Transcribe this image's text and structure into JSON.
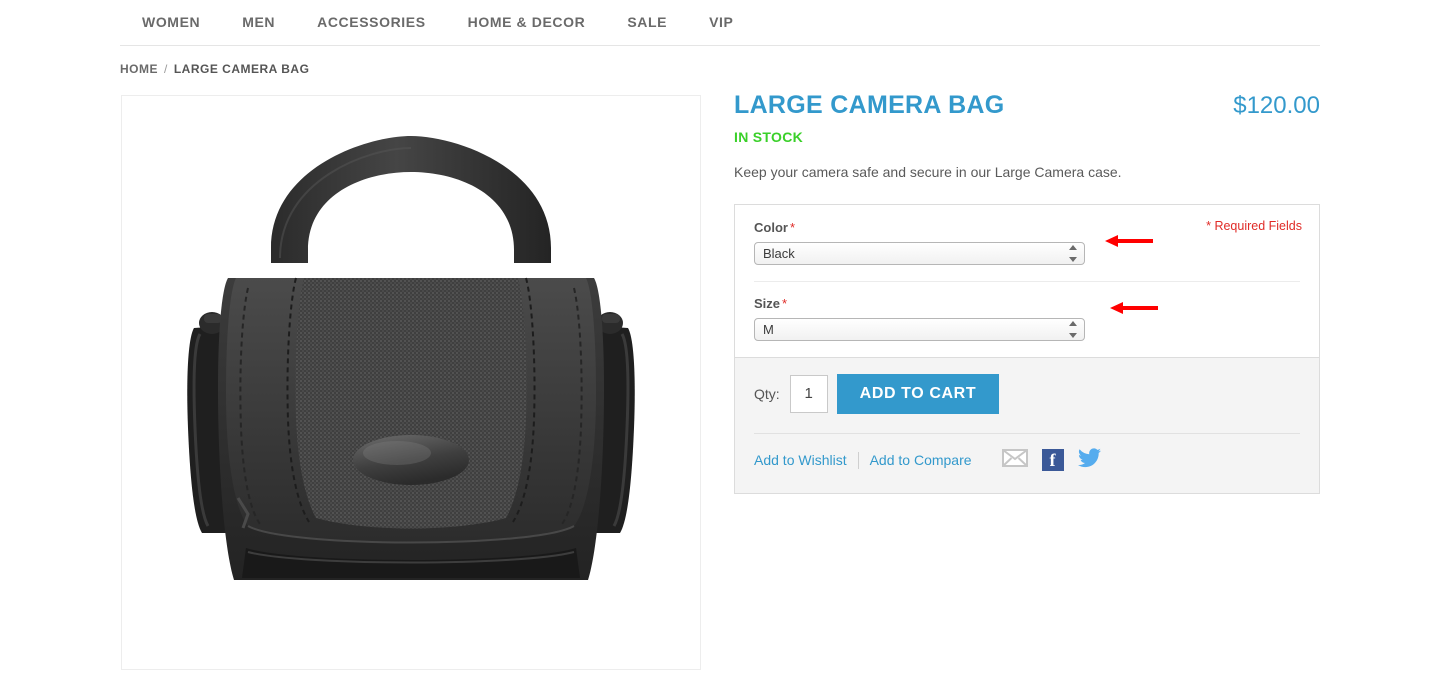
{
  "nav": {
    "items": [
      {
        "label": "WOMEN",
        "name": "nav-item-women"
      },
      {
        "label": "MEN",
        "name": "nav-item-men"
      },
      {
        "label": "ACCESSORIES",
        "name": "nav-item-accessories"
      },
      {
        "label": "HOME & DECOR",
        "name": "nav-item-home-decor"
      },
      {
        "label": "SALE",
        "name": "nav-item-sale"
      },
      {
        "label": "VIP",
        "name": "nav-item-vip"
      }
    ]
  },
  "breadcrumb": {
    "home": "HOME",
    "separator": "/",
    "current": "LARGE CAMERA BAG"
  },
  "product": {
    "title": "LARGE CAMERA BAG",
    "price": "$120.00",
    "stock_status": "IN STOCK",
    "description": "Keep your camera safe and secure in our Large Camera case.",
    "image_alt": "large-camera-bag-photo"
  },
  "options": {
    "required_note": "* Required Fields",
    "color": {
      "label": "Color",
      "required_star": "*",
      "value": "Black",
      "choices": [
        "Black"
      ]
    },
    "size": {
      "label": "Size",
      "required_star": "*",
      "value": "M",
      "choices": [
        "M"
      ]
    }
  },
  "cart": {
    "qty_label": "Qty:",
    "qty_value": "1",
    "add_to_cart_label": "ADD TO CART",
    "wishlist_label": "Add to Wishlist",
    "compare_label": "Add to Compare",
    "share": [
      {
        "name": "email-share-icon",
        "label": "email"
      },
      {
        "name": "facebook-share-icon",
        "label": "f"
      },
      {
        "name": "twitter-share-icon",
        "label": "twitter"
      }
    ]
  },
  "annotations": {
    "arrow_color": "#ff0000",
    "arrow_color_label": "red",
    "arrow_1_target": "color-select",
    "arrow_2_target": "size-select"
  },
  "colors": {
    "accent_blue": "#3399cc",
    "stock_green": "#3ad029",
    "required_red": "#e02b27",
    "facebook_blue": "#3b5998",
    "twitter_blue": "#55acee",
    "panel_grey": "#f4f4f4"
  }
}
